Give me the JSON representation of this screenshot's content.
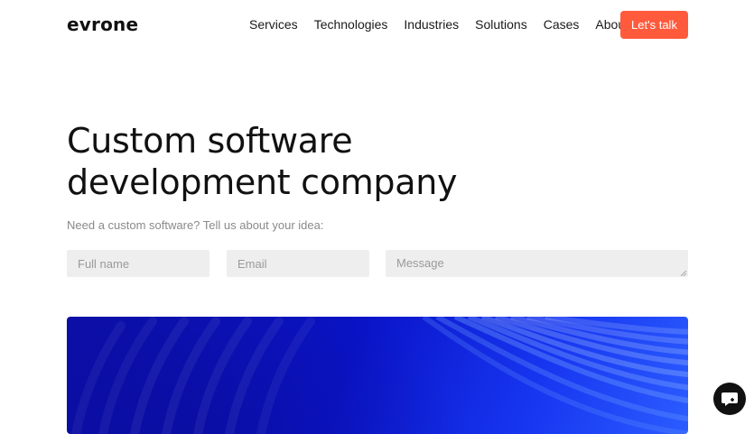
{
  "header": {
    "logo": "evrone",
    "nav": [
      "Services",
      "Technologies",
      "Industries",
      "Solutions",
      "Cases",
      "About"
    ],
    "cta_label": "Let's talk"
  },
  "hero": {
    "title_line1": "Custom software",
    "title_line2": "development company",
    "subtitle": "Need a custom software? Tell us about your idea:"
  },
  "form": {
    "name_placeholder": "Full name",
    "email_placeholder": "Email",
    "message_placeholder": "Message"
  },
  "colors": {
    "accent": "#ff5a3c",
    "banner_blue": "#0a14c9",
    "field_bg": "#eeeeee"
  },
  "icons": {
    "chat": "chat-icon"
  }
}
